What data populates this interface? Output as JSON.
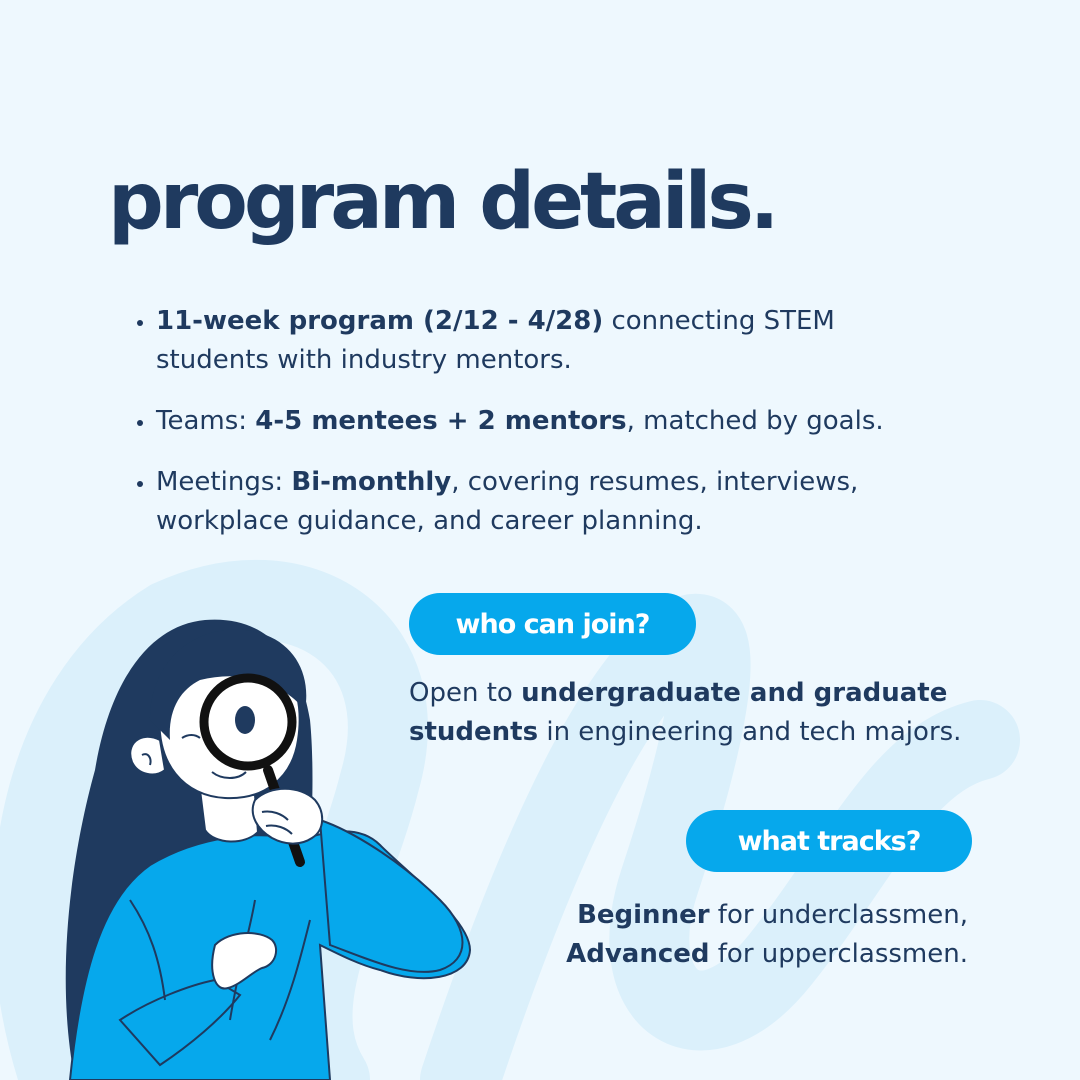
{
  "title": "program details.",
  "bullets": [
    {
      "bold": "11-week program (2/12 - 4/28)",
      "text": " connecting STEM students with industry mentors."
    },
    {
      "lead": "Teams: ",
      "bold": "4-5 mentees + 2 mentors",
      "text": ", matched by goals."
    },
    {
      "lead": "Meetings: ",
      "bold": "Bi-monthly",
      "text": ", covering resumes, interviews, workplace guidance, and career planning."
    }
  ],
  "who_can_join": {
    "label": "who can join?",
    "lead": "Open to ",
    "bold": "undergraduate and graduate students",
    "text": " in engineering and tech majors."
  },
  "what_tracks": {
    "label": "what tracks?",
    "line1_bold": "Beginner",
    "line1_text": " for underclassmen,",
    "line2_bold": "Advanced",
    "line2_text": " for upperclassmen."
  },
  "colors": {
    "background": "#eef8fe",
    "navy": "#1f3a5f",
    "accent_blue": "#06a8ec",
    "scribble": "#dbf0fb"
  },
  "illustration": {
    "icon": "person-with-magnifying-glass-icon"
  }
}
